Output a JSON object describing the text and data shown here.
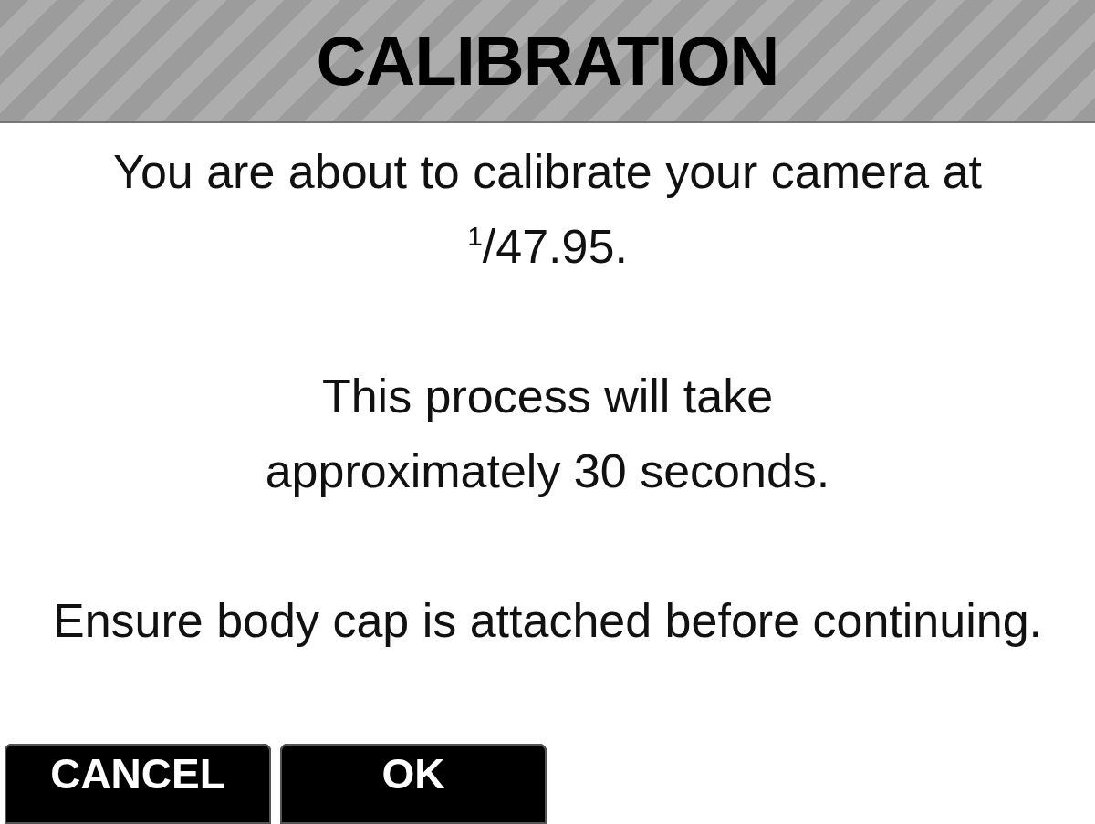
{
  "title": "CALIBRATION",
  "paragraphs": [
    "You are about to calibrate your camera at $^{1}$/47.95.",
    "This process will take approximately 30 seconds.",
    "Ensure body cap is attached before continuing."
  ],
  "buttons": [
    "CANCEL",
    "OK"
  ]
}
